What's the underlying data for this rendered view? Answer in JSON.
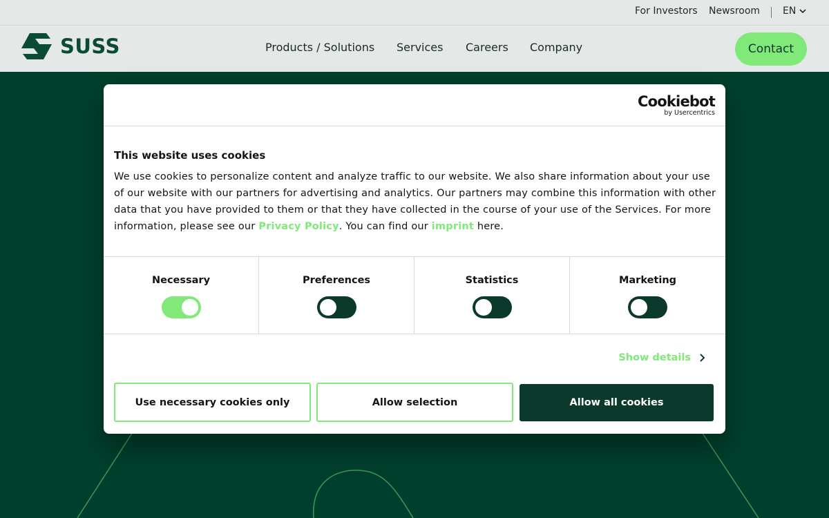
{
  "utility_bar": {
    "investors": "For Investors",
    "newsroom": "Newsroom",
    "language": "EN"
  },
  "header": {
    "logo_text": "SUSS",
    "nav": [
      "Products / Solutions",
      "Services",
      "Careers",
      "Company"
    ],
    "contact": "Contact"
  },
  "cookie_dialog": {
    "brand_name": "Cookiebot",
    "brand_sub": "by Usercentrics",
    "title": "This website uses cookies",
    "body_part1": "We use cookies to personalize content and analyze traffic to our website. We also share information about your use of our website with our partners for advertising and analytics. Our partners may combine this information with other data that you have provided to them or that they have collected in the course of your use of the Services. For more information, please see our ",
    "privacy_link": "Privacy Policy",
    "body_part2": ". You can find our ",
    "imprint_link": "imprint",
    "body_part3": " here.",
    "categories": [
      {
        "label": "Necessary",
        "enabled": true
      },
      {
        "label": "Preferences",
        "enabled": false
      },
      {
        "label": "Statistics",
        "enabled": false
      },
      {
        "label": "Marketing",
        "enabled": false
      }
    ],
    "show_details": "Show details",
    "btn_necessary": "Use necessary cookies only",
    "btn_selection": "Allow selection",
    "btn_all": "Allow all cookies"
  },
  "colors": {
    "brand_dark": "#0b3a2c",
    "brand_green": "#80e97a",
    "header_bg": "#e4e8e6",
    "page_bg": "#003f2d"
  }
}
